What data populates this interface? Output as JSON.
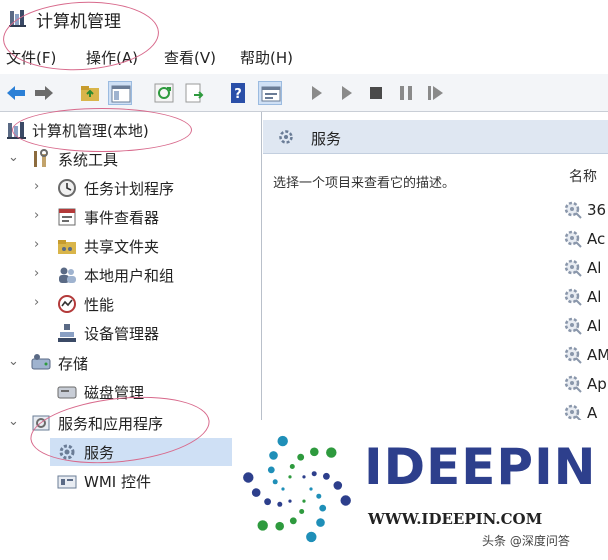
{
  "window": {
    "title": "计算机管理"
  },
  "menu": [
    {
      "label": "文件(F)"
    },
    {
      "label": "操作(A)"
    },
    {
      "label": "查看(V)"
    },
    {
      "label": "帮助(H)"
    }
  ],
  "toolbar": {
    "buttons": [
      "back-arrow-icon",
      "forward-arrow-icon",
      "up-folder-icon",
      "show-hide-tree-icon",
      "refresh-icon",
      "export-list-icon",
      "help-icon",
      "properties-icon",
      "play-icon",
      "play-next-icon",
      "stop-icon",
      "pause-icon",
      "restart-icon"
    ]
  },
  "tree": {
    "root": {
      "label": "计算机管理(本地)",
      "icon": "computer-management-icon"
    },
    "system_tools": {
      "label": "系统工具",
      "icon": "tools-icon",
      "children": [
        {
          "label": "任务计划程序",
          "icon": "clock-icon"
        },
        {
          "label": "事件查看器",
          "icon": "event-viewer-icon"
        },
        {
          "label": "共享文件夹",
          "icon": "shared-folder-icon"
        },
        {
          "label": "本地用户和组",
          "icon": "users-icon"
        },
        {
          "label": "性能",
          "icon": "performance-icon"
        },
        {
          "label": "设备管理器",
          "icon": "device-manager-icon"
        }
      ]
    },
    "storage": {
      "label": "存储",
      "icon": "storage-icon",
      "children": [
        {
          "label": "磁盘管理",
          "icon": "disk-icon"
        }
      ]
    },
    "services_apps": {
      "label": "服务和应用程序",
      "icon": "services-apps-icon",
      "children": [
        {
          "label": "服务",
          "icon": "services-gear-icon"
        },
        {
          "label": "WMI 控件",
          "icon": "wmi-icon"
        }
      ]
    }
  },
  "content": {
    "header_title": "服务",
    "description": "选择一个项目来查看它的描述。",
    "column_header": "名称",
    "services": [
      "36",
      "Ac",
      "Al",
      "Al",
      "Al",
      "AM",
      "Ap",
      "A"
    ]
  },
  "watermark": {
    "brand": "IDEEPIN",
    "url": "WWW.IDEEPIN.COM",
    "tag": "头条 @深度问答"
  },
  "colors": {
    "annotation": "#d86a8c",
    "header_band": "#dfe7f2",
    "brand": "#2d3f8c"
  }
}
